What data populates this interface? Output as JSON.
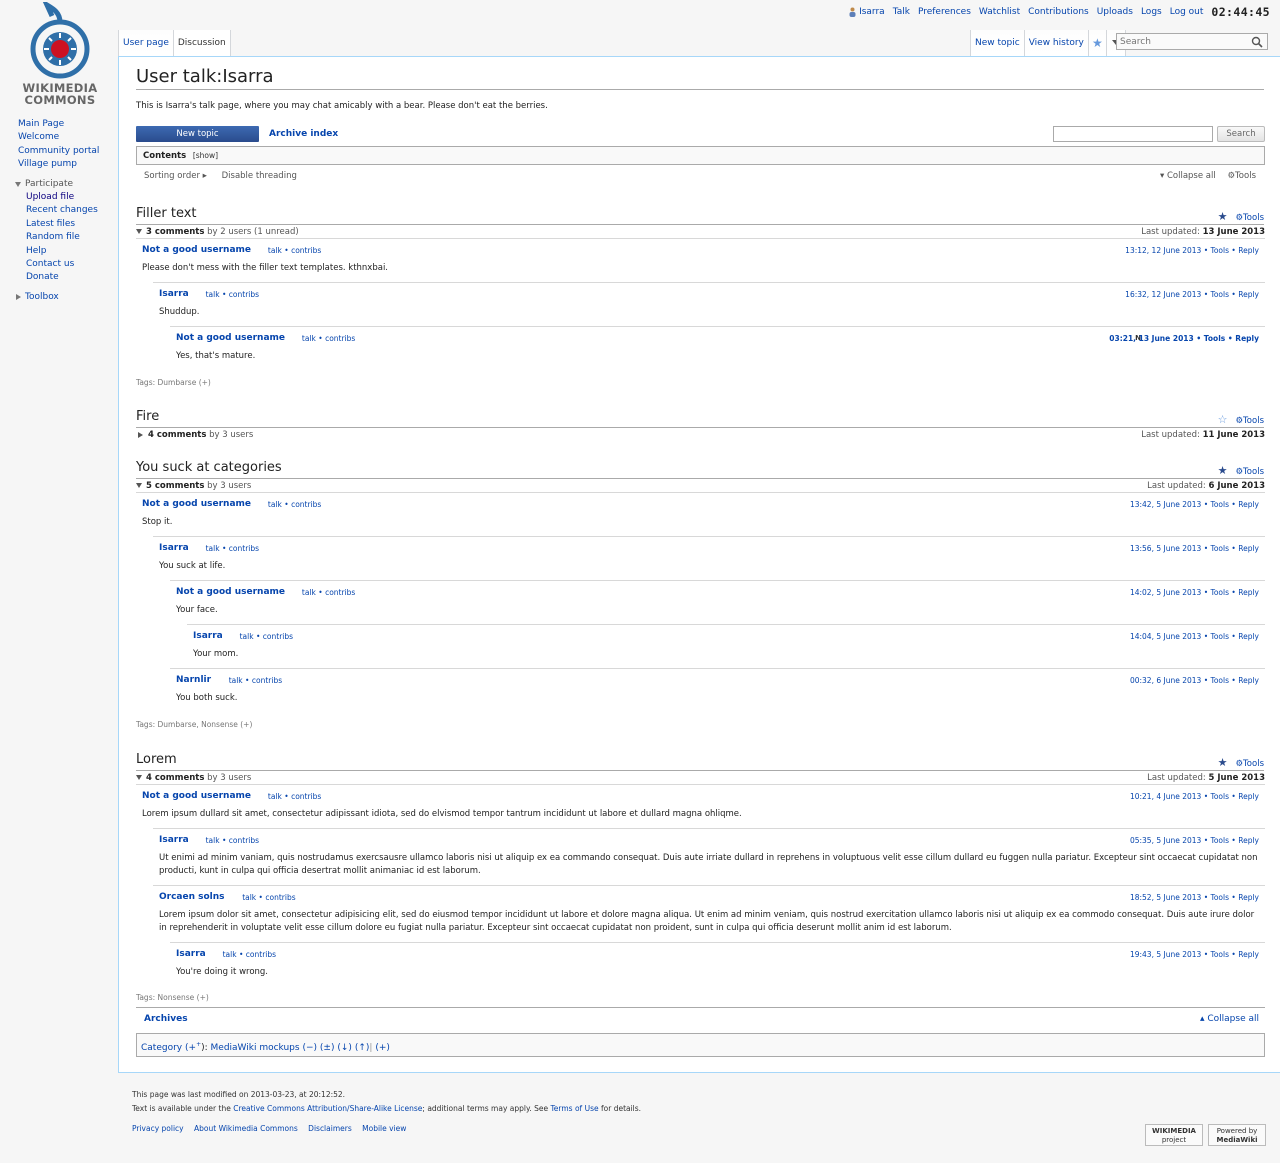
{
  "logo": {
    "line1": "WIKIMEDIA",
    "line2": "COMMONS"
  },
  "personal": {
    "username": "Isarra",
    "items": [
      "Talk",
      "Preferences",
      "Watchlist",
      "Contributions",
      "Uploads",
      "Logs",
      "Log out"
    ],
    "clock": "02:44:45"
  },
  "tabs": {
    "left": [
      "User page",
      "Discussion"
    ],
    "right": [
      "New topic",
      "View history"
    ]
  },
  "search": {
    "placeholder": "Search"
  },
  "sidebar": {
    "nav": [
      "Main Page",
      "Welcome",
      "Community portal",
      "Village pump"
    ],
    "participate": {
      "label": "Participate",
      "items": [
        "Upload file",
        "Recent changes",
        "Latest files",
        "Random file",
        "Help",
        "Contact us",
        "Donate"
      ]
    },
    "toolbox": "Toolbox"
  },
  "page": {
    "title": "User talk:Isarra",
    "intro": "This is Isarra's talk page, where you may chat amicably with a bear. Please don't eat the berries.",
    "new_topic": "New topic",
    "archive_index": "Archive index",
    "search_button": "Search",
    "contents": "Contents",
    "show": "[show]",
    "sorting": "Sorting order ▸",
    "disable_threading": "Disable threading",
    "collapse_all": "▾ Collapse all",
    "tools": "⚙Tools",
    "thread_tools": "⚙Tools"
  },
  "labels": {
    "talk": "talk",
    "dot": "•",
    "contribs": "contribs",
    "tools": "Tools",
    "reply": "Reply",
    "last_updated": "Last updated:",
    "tags": "Tags:",
    "new": "N"
  },
  "threads": [
    {
      "title": "Filler text",
      "starred": true,
      "count": "3 comments",
      "users": "by 2 users (1 unread)",
      "updated": "13 June 2013",
      "posts": [
        {
          "author": "Not a good username",
          "ts": "13:12, 12 June 2013",
          "body": "Please don't mess with the filler text templates. kthnxbai.",
          "depth": 0
        },
        {
          "author": "Isarra",
          "ts": "16:32, 12 June 2013",
          "body": "Shuddup.",
          "depth": 1
        },
        {
          "author": "Not a good username",
          "ts": "03:21, 13 June 2013",
          "body": "Yes, that's mature.",
          "depth": 2,
          "unread": true
        }
      ],
      "tags": "Dumbarse (+)"
    },
    {
      "title": "Fire",
      "starred": false,
      "count": "4 comments",
      "users": "by 3 users",
      "updated": "11 June 2013",
      "collapsed": true
    },
    {
      "title": "You suck at categories",
      "starred": true,
      "count": "5 comments",
      "users": "by 3 users",
      "updated": "6 June 2013",
      "posts": [
        {
          "author": "Not a good username",
          "ts": "13:42, 5 June 2013",
          "body": "Stop it.",
          "depth": 0
        },
        {
          "author": "Isarra",
          "ts": "13:56, 5 June 2013",
          "body": "You suck at life.",
          "depth": 1
        },
        {
          "author": "Not a good username",
          "ts": "14:02, 5 June 2013",
          "body": "Your face.",
          "depth": 2
        },
        {
          "author": "Isarra",
          "ts": "14:04, 5 June 2013",
          "body": "Your mom.",
          "depth": 3
        },
        {
          "author": "Narnlir",
          "ts": "00:32, 6 June 2013",
          "body": "You both suck.",
          "depth": 2
        }
      ],
      "tags": "Dumbarse, Nonsense (+)"
    },
    {
      "title": "Lorem",
      "starred": true,
      "count": "4 comments",
      "users": "by 3 users",
      "updated": "5 June 2013",
      "posts": [
        {
          "author": "Not a good username",
          "ts": "10:21, 4 June 2013",
          "body": "Lorem ipsum dullard sit amet, consectetur adipissant idiota, sed do elvismod tempor tantrum incididunt ut labore et dullard magna ohliqme.",
          "depth": 0
        },
        {
          "author": "Isarra",
          "ts": "05:35, 5 June 2013",
          "body": "Ut enimi ad minim vaniam, quis nostrudamus exercsausre ullamco laboris nisi ut aliquip ex ea commando consequat. Duis aute irriate dullard in reprehens in voluptuous velit esse cillum dullard eu fuggen nulla pariatur. Excepteur sint occaecat cupidatat non producti, kunt in culpa qui officia desertrat mollit animaniac id est laborum.",
          "depth": 1
        },
        {
          "author": "Orcaen solns",
          "ts": "18:52, 5 June 2013",
          "body": "Lorem ipsum dolor sit amet, consectetur adipisicing elit, sed do eiusmod tempor incididunt ut labore et dolore magna aliqua. Ut enim ad minim veniam, quis nostrud exercitation ullamco laboris nisi ut aliquip ex ea commodo consequat. Duis aute irure dolor in reprehenderit in voluptate velit esse cillum dolore eu fugiat nulla pariatur. Excepteur sint occaecat cupidatat non proident, sunt in culpa qui officia deserunt mollit anim id est laborum.",
          "depth": 1
        },
        {
          "author": "Isarra",
          "ts": "19:43, 5 June 2013",
          "body": "You're doing it wrong.",
          "depth": 2
        }
      ],
      "tags": "Nonsense (+)"
    }
  ],
  "archives": {
    "title": "Archives",
    "collapse": "▴ Collapse all"
  },
  "catlinks": {
    "label": "Category",
    "plus": "(+",
    "sup": "+",
    "close": "):",
    "cat": "MediaWiki mockups",
    "ops": [
      "(−)",
      "(±)",
      "(↓)",
      "(↑)",
      "(+)"
    ]
  },
  "footer": {
    "modified": "This page was last modified on 2013-03-23, at 20:12:52.",
    "license_pre": "Text is available under the ",
    "license_link": "Creative Commons Attribution/Share-Alike License",
    "license_mid": "; additional terms may apply. See ",
    "terms_link": "Terms of Use",
    "license_post": " for details.",
    "places": [
      "Privacy policy",
      "About Wikimedia Commons",
      "Disclaimers",
      "Mobile view"
    ],
    "badge1": [
      "WIKIMEDIA",
      "project"
    ],
    "badge2": [
      "Powered by",
      "MediaWiki"
    ]
  }
}
